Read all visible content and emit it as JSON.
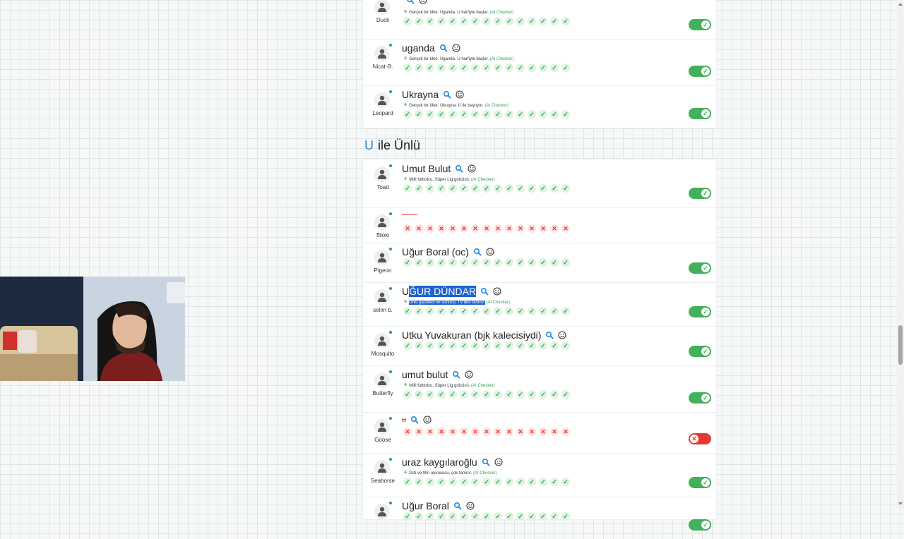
{
  "section": {
    "letter": "U",
    "title": "ile Ünlü"
  },
  "country_rows": [
    {
      "player": "Duck",
      "answer": "",
      "note": "Gerçek bir ülke: Uganda. U harfiyle başlar.",
      "checker": "(AI Checker)",
      "status": "valid"
    },
    {
      "player": "Nicat Ə.",
      "answer": "uganda",
      "note": "Gerçek bir ülke: Uganda. U harfiyle başlar.",
      "checker": "(AI Checker)",
      "status": "valid"
    },
    {
      "player": "Leopard",
      "answer": "Ukrayna",
      "note": "Gerçek bir ülke: Ukrayna. U ile başlıyor.",
      "checker": "(AI Checker)",
      "status": "valid"
    }
  ],
  "celebrity_rows": [
    {
      "player": "Toad",
      "answer": "Umut Bulut",
      "note": "Milli futbolcu, Süper Lig golcüsü.",
      "checker": "(AI Checker)",
      "status": "valid"
    },
    {
      "player": "fflioki",
      "answer": "",
      "note": "",
      "checker": "",
      "status": "empty"
    },
    {
      "player": "Pigeon",
      "answer": "Uğur Boral (oc)",
      "note": "",
      "checker": "",
      "status": "valid"
    },
    {
      "player": "selim b.",
      "answer": "UĞUR DÜNDAR",
      "note": "Ünlü gazeteci ve sunucu, TV'den tanınır.",
      "checker": "(AI Checker)",
      "status": "valid"
    },
    {
      "player": "Mosquito",
      "answer": "Utku Yuvakuran (bjk kalecisiydi)",
      "note": "",
      "checker": "",
      "status": "valid"
    },
    {
      "player": "Butterfly",
      "answer": "umut bulut",
      "note": "Milli futbolcu, Süper Lig golcüsü.",
      "checker": "(AI Checker)",
      "status": "valid"
    },
    {
      "player": "Goose",
      "answer": "u",
      "note": "",
      "checker": "",
      "status": "invalid"
    },
    {
      "player": "Seahorse",
      "answer": "uraz kaygılaroğlu",
      "note": "Dizi ve film oyuncusu, çok tanınır.",
      "checker": "(AI Checker)",
      "status": "valid"
    },
    {
      "player": "",
      "answer": "Uğur Boral",
      "note": "",
      "checker": "",
      "status": "valid"
    }
  ],
  "vote_count": 15,
  "icons": {
    "search": "search-icon",
    "emoji": "emoji-icon",
    "user": "user-icon"
  },
  "colors": {
    "valid": "#43b05c",
    "invalid": "#e53935",
    "accent": "#1e88e5"
  }
}
